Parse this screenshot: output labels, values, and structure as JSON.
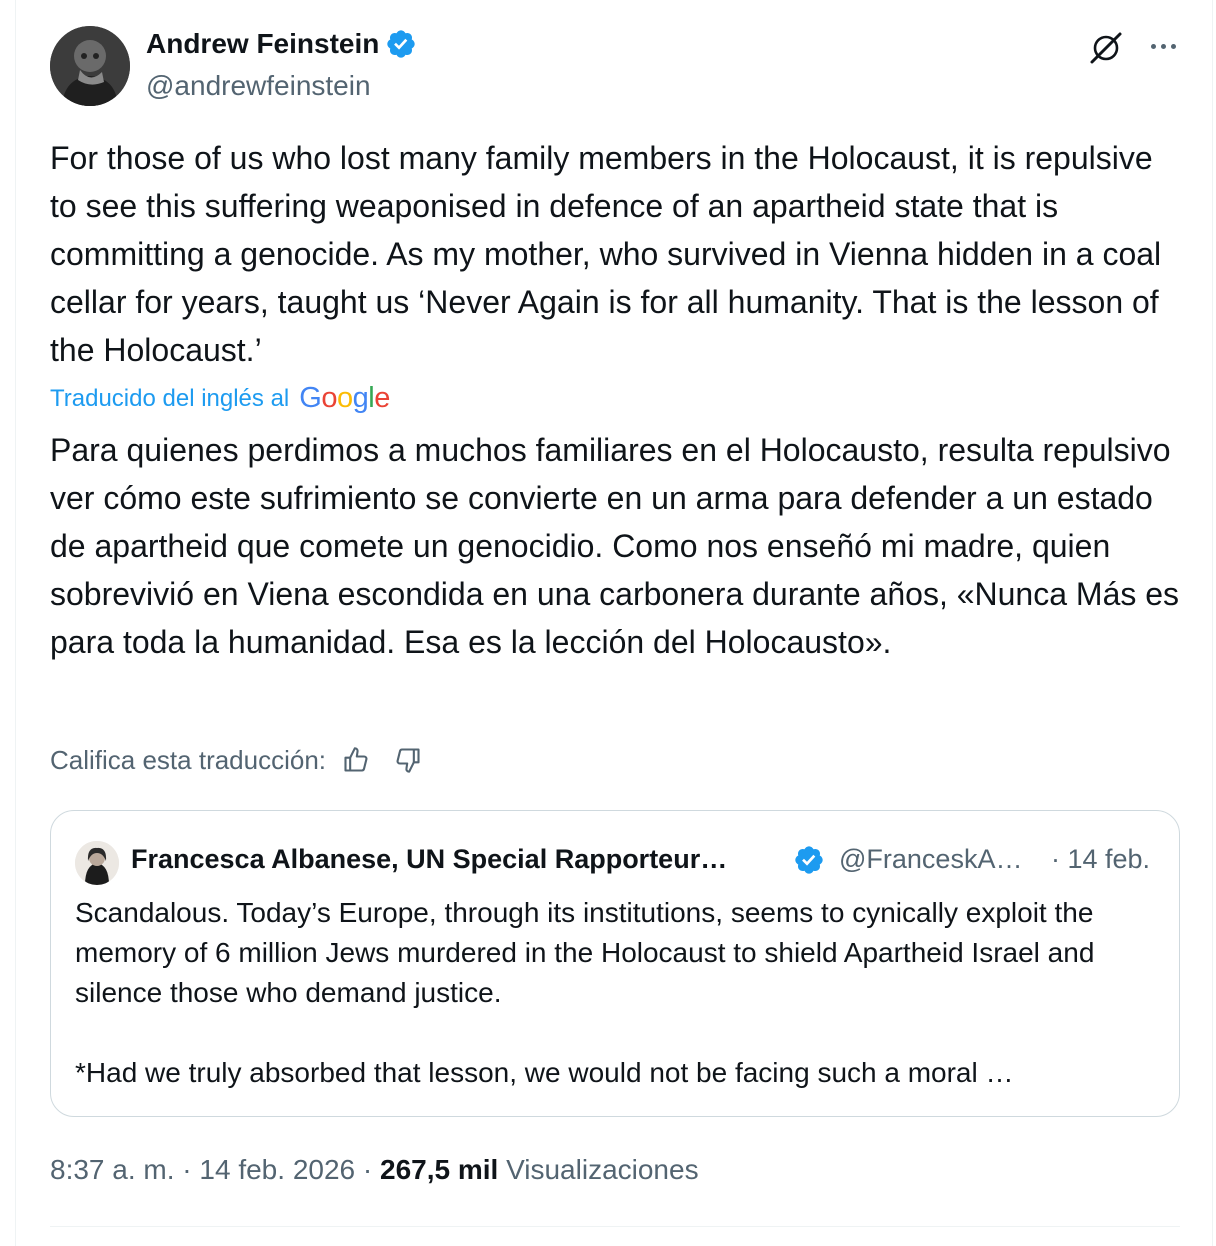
{
  "author": {
    "display_name": "Andrew Feinstein",
    "handle": "@andrewfeinstein",
    "verified_color": "#1d9bf0"
  },
  "icons": {
    "verified": "verified-badge-icon",
    "grok": "grok-icon",
    "more": "more-options-icon",
    "thumbs_up": "thumbs-up-icon",
    "thumbs_down": "thumbs-down-icon"
  },
  "tweet": {
    "text": "For those of us who lost many family members in the Holocaust, it is repulsive to see this suffering weaponised in defence of an apartheid state that is committing a genocide. As my mother, who survived in Vienna hidden in a coal cellar for years, taught us ‘Never Again is for all humanity. That is the lesson of the Holocaust.’"
  },
  "translation": {
    "label": "Traducido del inglés al",
    "provider": "Google",
    "text": "Para quienes perdimos a muchos familiares en el Holocausto, resulta repulsivo ver cómo este sufrimiento se convierte en un arma para defender a un estado de apartheid que comete un genocidio. Como nos enseñó mi madre, quien sobrevivió en Viena escondida en una carbonera durante años, «Nunca Más es para toda la humanidad. Esa es la lección del Holocausto».",
    "rate_label": "Califica esta traducción:"
  },
  "quote": {
    "display_name": "Francesca Albanese, UN Special Rapporteur…",
    "handle": "@FranceskA…",
    "date": "· 14 feb.",
    "text": "Scandalous. Today’s Europe, through its institutions, seems to cynically exploit the memory of 6 million Jews murdered in the Holocaust to shield Apartheid Israel and silence those who demand justice.",
    "text_2": "*Had we truly absorbed that lesson, we would not be facing such a moral …"
  },
  "meta": {
    "time": "8:37 a. m.",
    "separator": "·",
    "date": "14 feb. 2026",
    "views_count": "267,5 mil",
    "views_label": "Visualizaciones"
  },
  "colors": {
    "text": "#0f1419",
    "secondary": "#536471",
    "accent": "#1d9bf0",
    "border": "#cfd9de"
  }
}
